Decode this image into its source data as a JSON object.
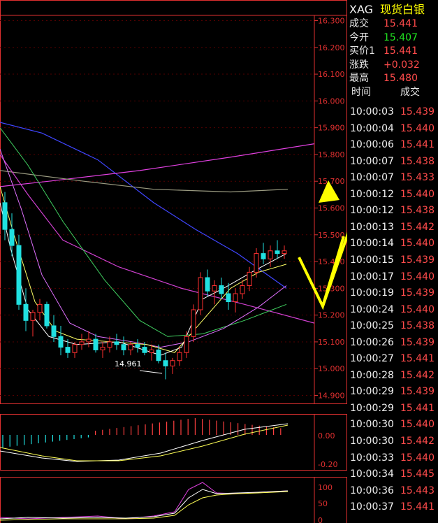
{
  "header": {
    "symbol": "XAG",
    "name": "现货白银"
  },
  "quote": [
    {
      "label": "成交",
      "value": "15.441",
      "color": "#ff4b4b"
    },
    {
      "label": "今开",
      "value": "15.407",
      "color": "#21e321"
    },
    {
      "label": "买价1",
      "value": "15.441",
      "color": "#ff4b4b"
    },
    {
      "label": "涨跌",
      "value": "+0.032",
      "color": "#ff4b4b"
    },
    {
      "label": "最高",
      "value": "15.480",
      "color": "#ff4b4b"
    }
  ],
  "ticks_header": {
    "time": "时间",
    "price": "成交"
  },
  "ticks": [
    {
      "time": "10:00:03",
      "price": "15.439"
    },
    {
      "time": "10:00:04",
      "price": "15.440"
    },
    {
      "time": "10:00:06",
      "price": "15.441"
    },
    {
      "time": "10:00:07",
      "price": "15.438"
    },
    {
      "time": "10:00:07",
      "price": "15.433"
    },
    {
      "time": "10:00:12",
      "price": "15.440"
    },
    {
      "time": "10:00:12",
      "price": "15.438"
    },
    {
      "time": "10:00:13",
      "price": "15.442"
    },
    {
      "time": "10:00:14",
      "price": "15.440"
    },
    {
      "time": "10:00:15",
      "price": "15.439"
    },
    {
      "time": "10:00:17",
      "price": "15.440"
    },
    {
      "time": "10:00:19",
      "price": "15.439"
    },
    {
      "time": "10:00:24",
      "price": "15.440"
    },
    {
      "time": "10:00:25",
      "price": "15.438"
    },
    {
      "time": "10:00:26",
      "price": "15.439"
    },
    {
      "time": "10:00:27",
      "price": "15.441"
    },
    {
      "time": "10:00:28",
      "price": "15.442"
    },
    {
      "time": "10:00:29",
      "price": "15.439"
    },
    {
      "time": "10:00:29",
      "price": "15.441"
    },
    {
      "time": "10:00:30",
      "price": "15.440"
    },
    {
      "time": "10:00:30",
      "price": "15.442"
    },
    {
      "time": "10:00:33",
      "price": "15.440"
    },
    {
      "time": "10:00:34",
      "price": "15.445"
    },
    {
      "time": "10:00:36",
      "price": "15.443"
    },
    {
      "time": "10:00:37",
      "price": "15.441"
    }
  ],
  "chart_data": {
    "type": "candlestick",
    "y_axis_labels": [
      "16.300",
      "16.200",
      "16.100",
      "16.000",
      "15.900",
      "15.800",
      "15.700",
      "15.600",
      "15.500",
      "15.400",
      "15.300",
      "15.200",
      "15.100",
      "15.000",
      "14.900"
    ],
    "ylim": [
      14.87,
      16.33
    ],
    "low_annotation": "14.961",
    "macd_labels": [
      "0.00",
      "-0.20"
    ],
    "kdj_labels": [
      "100",
      "50",
      "0"
    ],
    "candles": [
      [
        15.62,
        15.66,
        15.48,
        15.52
      ],
      [
        15.52,
        15.58,
        15.42,
        15.46
      ],
      [
        15.46,
        15.5,
        15.22,
        15.24
      ],
      [
        15.24,
        15.3,
        15.14,
        15.18
      ],
      [
        15.18,
        15.22,
        15.12,
        15.21
      ],
      [
        15.21,
        15.26,
        15.18,
        15.24
      ],
      [
        15.24,
        15.25,
        15.15,
        15.16
      ],
      [
        15.16,
        15.2,
        15.1,
        15.12
      ],
      [
        15.12,
        15.16,
        15.05,
        15.08
      ],
      [
        15.08,
        15.11,
        15.04,
        15.06
      ],
      [
        15.06,
        15.1,
        15.04,
        15.09
      ],
      [
        15.09,
        15.13,
        15.07,
        15.1
      ],
      [
        15.1,
        15.14,
        15.08,
        15.11
      ],
      [
        15.11,
        15.13,
        15.06,
        15.07
      ],
      [
        15.07,
        15.1,
        15.04,
        15.08
      ],
      [
        15.08,
        15.12,
        15.06,
        15.1
      ],
      [
        15.1,
        15.13,
        15.07,
        15.09
      ],
      [
        15.09,
        15.12,
        15.05,
        15.07
      ],
      [
        15.07,
        15.1,
        15.05,
        15.09
      ],
      [
        15.09,
        15.11,
        15.06,
        15.08
      ],
      [
        15.08,
        15.1,
        15.05,
        15.06
      ],
      [
        15.06,
        15.09,
        15.03,
        15.07
      ],
      [
        15.07,
        15.09,
        15.02,
        15.03
      ],
      [
        15.03,
        15.06,
        14.96,
        15.01
      ],
      [
        15.01,
        15.04,
        14.98,
        15.03
      ],
      [
        15.03,
        15.08,
        15.01,
        15.06
      ],
      [
        15.06,
        15.14,
        15.04,
        15.12
      ],
      [
        15.12,
        15.24,
        15.1,
        15.22
      ],
      [
        15.22,
        15.36,
        15.2,
        15.34
      ],
      [
        15.34,
        15.37,
        15.27,
        15.29
      ],
      [
        15.29,
        15.33,
        15.24,
        15.31
      ],
      [
        15.31,
        15.34,
        15.26,
        15.28
      ],
      [
        15.28,
        15.32,
        15.22,
        15.25
      ],
      [
        15.25,
        15.3,
        15.21,
        15.28
      ],
      [
        15.28,
        15.33,
        15.26,
        15.31
      ],
      [
        15.31,
        15.38,
        15.29,
        15.36
      ],
      [
        15.36,
        15.45,
        15.34,
        15.43
      ],
      [
        15.43,
        15.47,
        15.39,
        15.41
      ],
      [
        15.41,
        15.46,
        15.38,
        15.44
      ],
      [
        15.44,
        15.48,
        15.41,
        15.43
      ],
      [
        15.43,
        15.46,
        15.41,
        15.44
      ]
    ]
  }
}
